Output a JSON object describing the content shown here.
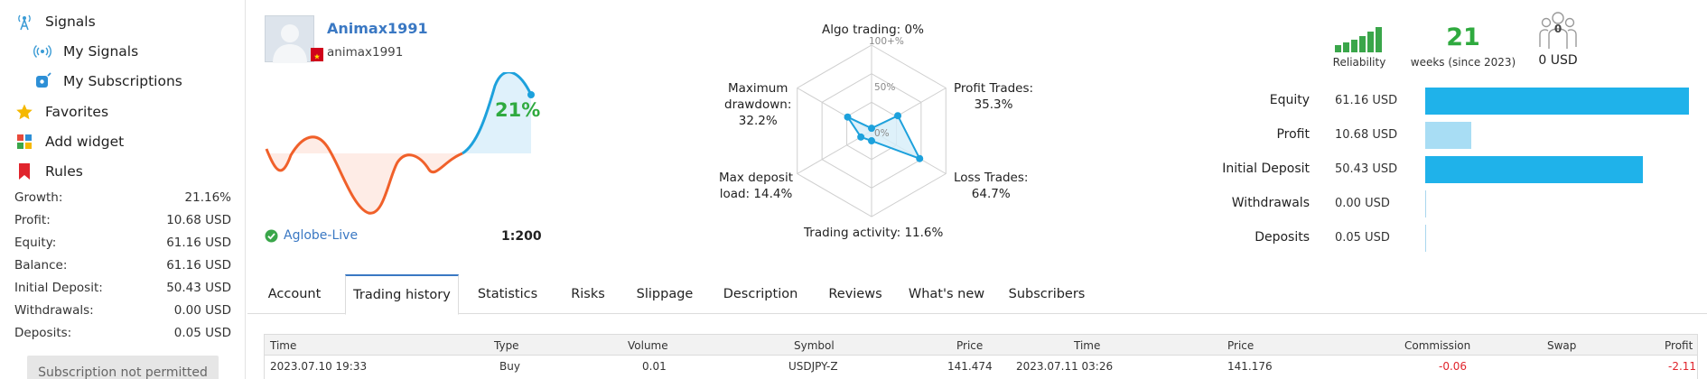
{
  "sidebar": {
    "nav": [
      {
        "label": "Signals",
        "icon": "signal-antenna-icon"
      },
      {
        "label": "My Signals",
        "icon": "broadcast-icon"
      },
      {
        "label": "My Subscriptions",
        "icon": "subscription-icon"
      },
      {
        "label": "Favorites",
        "icon": "star-icon"
      },
      {
        "label": "Add widget",
        "icon": "widget-icon"
      },
      {
        "label": "Rules",
        "icon": "bookmark-icon"
      }
    ],
    "stats": [
      {
        "label": "Growth:",
        "value": "21.16%"
      },
      {
        "label": "Profit:",
        "value": "10.68 USD"
      },
      {
        "label": "Equity:",
        "value": "61.16 USD"
      },
      {
        "label": "Balance:",
        "value": "61.16 USD"
      },
      {
        "label": "Initial Deposit:",
        "value": "50.43 USD"
      },
      {
        "label": "Withdrawals:",
        "value": "0.00 USD"
      },
      {
        "label": "Deposits:",
        "value": "0.05 USD"
      }
    ],
    "subscription_button": "Subscription not permitted"
  },
  "profile": {
    "username": "Animax1991",
    "login": "animax1991",
    "growth": "21%",
    "broker": "Aglobe-Live",
    "leverage": "1:200"
  },
  "radar": {
    "scale_labels": [
      "100+%",
      "50%",
      "0%"
    ],
    "axes": [
      {
        "label": "Algo trading: 0%",
        "value": 0
      },
      {
        "label": "Profit Trades:\n35.3%",
        "value": 35.3
      },
      {
        "label": "Loss Trades:\n64.7%",
        "value": 64.7
      },
      {
        "label": "Trading activity: 11.6%",
        "value": 11.6
      },
      {
        "label": "Max deposit\nload: 14.4%",
        "value": 14.4
      },
      {
        "label": "Maximum\ndrawdown:\n32.2%",
        "value": 32.2
      }
    ],
    "colors": {
      "line": "#1da1dc",
      "fill": "#d6eef9"
    }
  },
  "summary": {
    "reliability_label": "Reliability",
    "weeks_value": "21",
    "weeks_label": "weeks (since 2023)",
    "subscribers_count": "0",
    "subscribers_value": "0 USD",
    "bars": [
      {
        "label": "Equity",
        "value": "61.16 USD",
        "amount": 61.16,
        "color": "#1fb2ea"
      },
      {
        "label": "Profit",
        "value": "10.68 USD",
        "amount": 10.68,
        "color": "#a8ddf4"
      },
      {
        "label": "Initial Deposit",
        "value": "50.43 USD",
        "amount": 50.43,
        "color": "#1fb2ea"
      },
      {
        "label": "Withdrawals",
        "value": "0.00 USD",
        "amount": 0,
        "color": "#aad7ee"
      },
      {
        "label": "Deposits",
        "value": "0.05 USD",
        "amount": 0.05,
        "color": "#aad7ee"
      }
    ]
  },
  "tabs": [
    {
      "label": "Account",
      "active": false
    },
    {
      "label": "Trading history",
      "active": true
    },
    {
      "label": "Statistics",
      "active": false
    },
    {
      "label": "Risks",
      "active": false
    },
    {
      "label": "Slippage",
      "active": false
    },
    {
      "label": "Description",
      "active": false
    },
    {
      "label": "Reviews",
      "active": false
    },
    {
      "label": "What's new",
      "active": false
    },
    {
      "label": "Subscribers",
      "active": false
    }
  ],
  "table": {
    "headers": [
      "Time",
      "Type",
      "Volume",
      "Symbol",
      "Price",
      "Time",
      "Price",
      "Commission",
      "Swap",
      "Profit"
    ],
    "rows": [
      [
        "2023.07.10 19:33",
        "Buy",
        "0.01",
        "USDJPY-Z",
        "141.474",
        "2023.07.11 03:26",
        "141.176",
        "-0.06",
        "",
        "-2.11"
      ]
    ]
  },
  "colors": {
    "accent": "#3a78c3",
    "positive": "#2faa3f",
    "negative": "#e0242c",
    "growth_line": "#1da1dc",
    "loss_line": "#f0602a"
  }
}
